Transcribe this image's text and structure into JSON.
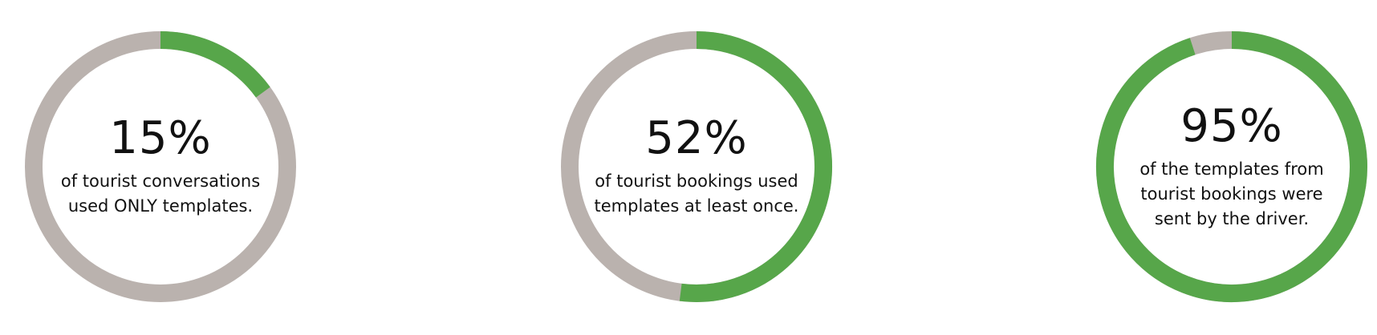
{
  "colors": {
    "filled": "#57a64a",
    "remaining": "#bab2ae",
    "text": "#111111"
  },
  "chart_data": [
    {
      "type": "pie",
      "style": "donut",
      "categories": [
        "filled",
        "remaining"
      ],
      "values": [
        15,
        85
      ],
      "value_label": "15%",
      "caption": "of tourist conversations\nused ONLY templates."
    },
    {
      "type": "pie",
      "style": "donut",
      "categories": [
        "filled",
        "remaining"
      ],
      "values": [
        52,
        48
      ],
      "value_label": "52%",
      "caption": "of tourist bookings used\ntemplates at least once."
    },
    {
      "type": "pie",
      "style": "donut",
      "categories": [
        "filled",
        "remaining"
      ],
      "values": [
        95,
        5
      ],
      "value_label": "95%",
      "caption": "of the templates from\ntourist bookings were\nsent by the driver."
    }
  ]
}
